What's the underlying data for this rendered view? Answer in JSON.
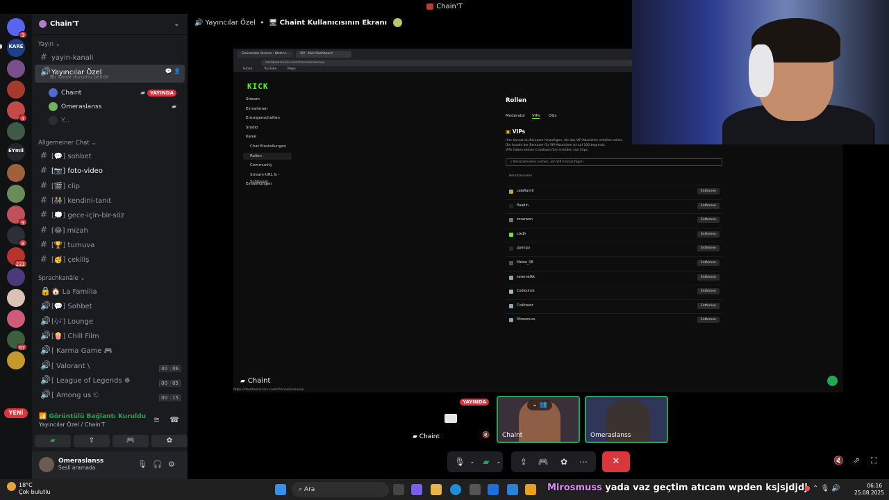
{
  "window": {
    "title": "Chain'T"
  },
  "rail": {
    "servers": [
      {
        "label": "",
        "badge": "3",
        "color": "#5865f2"
      },
      {
        "label": "KARE",
        "badge": "",
        "color": "#1e3f8a"
      },
      {
        "label": "",
        "badge": "",
        "color": "#7a4f8b"
      },
      {
        "label": "",
        "badge": "",
        "color": "#a43b2d"
      },
      {
        "label": "",
        "badge": "4",
        "color": "#c44a4a"
      },
      {
        "label": "",
        "badge": "",
        "color": "#3f5a47"
      },
      {
        "label": "EYmil",
        "badge": "",
        "color": "#24262b"
      },
      {
        "label": "",
        "badge": "",
        "color": "#a0603a"
      },
      {
        "label": "",
        "badge": "",
        "color": "#6a8c5a"
      },
      {
        "label": "",
        "badge": "9",
        "color": "#c0505a"
      },
      {
        "label": "",
        "badge": "8",
        "color": "#2c2f36"
      },
      {
        "label": "",
        "badge": "221",
        "color": "#b8322e"
      },
      {
        "label": "",
        "badge": "",
        "color": "#4a3a7a"
      },
      {
        "label": "",
        "badge": "",
        "color": "#d9c3b5"
      },
      {
        "label": "",
        "badge": "",
        "color": "#d05a7a"
      },
      {
        "label": "",
        "badge": "97",
        "color": "#3e5f3e"
      },
      {
        "label": "",
        "badge": "",
        "color": "#c49a2a"
      }
    ],
    "new_label": "YENİ"
  },
  "sidebar": {
    "guild": "Chain'T",
    "cat_yayin": "Yayın",
    "ch_yayin_kanali": "yayin-kanali",
    "active_channel": "Yayıncılar Özel",
    "active_status": "Bir kanal durumu belirle",
    "voice_users": [
      {
        "name": "Chaint",
        "live": "YAYINDA",
        "color": "#4f6bd1"
      },
      {
        "name": "Omeraslanss",
        "live": "",
        "color": "#6fb35a"
      },
      {
        "name": "Y...",
        "live": "",
        "color": "#2b2d31"
      }
    ],
    "cat_genel": "Allgemeiner Chat",
    "text_channels": [
      {
        "name": "[💬] sohbet",
        "bright": false
      },
      {
        "name": "[📷] foto-video",
        "bright": true
      },
      {
        "name": "[🎬] clip",
        "bright": false
      },
      {
        "name": "[👫] kendini-tanıt",
        "bright": false
      },
      {
        "name": "[💭] gece-için-bir-söz",
        "bright": false
      },
      {
        "name": "[😂] mizah",
        "bright": false
      },
      {
        "name": "[🏆] turnuva",
        "bright": false
      },
      {
        "name": "[🥳] çekiliş",
        "bright": false
      }
    ],
    "cat_sprach": "Sprachkanäle",
    "voice_channels": [
      {
        "name": "🏠 La Familia",
        "c1": "",
        "c2": ""
      },
      {
        "name": "[💬] Sohbet",
        "c1": "",
        "c2": ""
      },
      {
        "name": "[🎶] Lounge",
        "c1": "",
        "c2": ""
      },
      {
        "name": "[🍿] Chill Film",
        "c1": "",
        "c2": ""
      },
      {
        "name": "[ Karma Game 🎮",
        "c1": "",
        "c2": ""
      },
      {
        "name": "[ Valorant \\",
        "c1": "00",
        "c2": "06"
      },
      {
        "name": "[ League of Legends ☸",
        "c1": "00",
        "c2": "05"
      },
      {
        "name": "[ Among us ඞ",
        "c1": "00",
        "c2": "15"
      }
    ],
    "voice_status": "Görüntülü Bağlantı Kuruldu",
    "voice_location": "Yayıncılar Özel / Chain'T",
    "user_name": "Omeraslanss",
    "user_status": "Sesli aramada"
  },
  "main": {
    "header_channel": "Yayıncılar Özel",
    "header_stream": "Chaint Kullanıcısının Ekranı",
    "stream_label": "Chaint",
    "status_url": "https://dashboard.kick.com/channel/roles/vip"
  },
  "browser": {
    "tab1": "Streamlabs Stream - Watch L...",
    "tab2": "VIP - Kick Dashboard",
    "url": "dashboard.kick.com/channel/roles/vip",
    "bookmarks": [
      "Gmail",
      "YouTube",
      "Maps"
    ]
  },
  "kick": {
    "logo": "KICK",
    "nav": [
      {
        "label": "Stream",
        "sel": false,
        "sub": false
      },
      {
        "label": "Einnahmen",
        "sel": false,
        "sub": false
      },
      {
        "label": "Errungenschaften",
        "sel": false,
        "sub": false
      },
      {
        "label": "Studio",
        "sel": false,
        "sub": false
      },
      {
        "label": "Kanal",
        "sel": false,
        "sub": false
      },
      {
        "label": "Chat Einstellungen",
        "sel": false,
        "sub": true
      },
      {
        "label": "Rollen",
        "sel": true,
        "sub": true
      },
      {
        "label": "Community",
        "sel": false,
        "sub": true
      },
      {
        "label": "Stream-URL & -Schlüssel",
        "sel": false,
        "sub": true
      },
      {
        "label": "Einstellungen",
        "sel": false,
        "sub": false
      }
    ],
    "title": "Rollen",
    "tabs": [
      "Moderator",
      "VIPs",
      "OGs"
    ],
    "section": "VIPs",
    "desc": [
      "Hier kannst du Benutzer hinzufügen, die das VIP-Abzeichen erhalten sollen.",
      "Die Anzahl der Benutzer für VIP-Abzeichen ist auf 100 begrenzt.",
      "VIPs haben keinen Cooldown fürs erstellen von Clips."
    ],
    "search_placeholder": "Benutzername suchen, um VIP hinzuzufügen",
    "col_header": "Benutzername",
    "remove_label": "Entfernen",
    "users": [
      "calaflam0",
      "flaadin",
      "zorarwen",
      "cixdh",
      "ppengu",
      "Meloo_08",
      "keremefkk",
      "Codexinsk",
      "CixKreetz",
      "Mirosmuss"
    ]
  },
  "call": {
    "tile1_live": "YAYINDA",
    "tile1_name": "Chaint",
    "tile2_name": "Chaint",
    "tile3_name": "Omeraslanss"
  },
  "taskbar": {
    "temp": "18°C",
    "weather": "Çok bulutlu",
    "search": "Ara",
    "ticker_name": "Mirosmuss",
    "ticker_text": "yada vaz geçtim atıcam wpden ksjsjdjdj",
    "time": "06:16",
    "date": "25.08.2025"
  }
}
